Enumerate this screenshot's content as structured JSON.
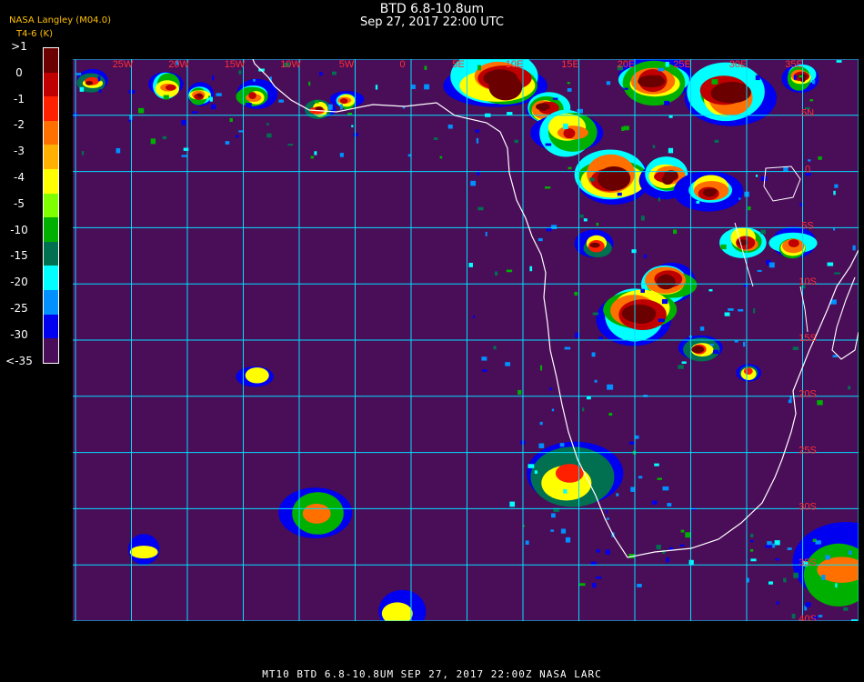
{
  "header": {
    "title": "BTD 6.8-10.8um",
    "datetime": "Sep 27, 2017 22:00 UTC",
    "credit": "NASA Langley (M04.0)",
    "units": "T4-6 (K)"
  },
  "legend": {
    "labels": [
      ">1",
      "0",
      "-1",
      "-2",
      "-3",
      "-4",
      "-5",
      "-10",
      "-15",
      "-20",
      "-25",
      "-30",
      "<-35"
    ],
    "colors": [
      "#6b0000",
      "#c00000",
      "#ff2000",
      "#ff7000",
      "#ffb000",
      "#ffff00",
      "#80ff00",
      "#00b000",
      "#007050",
      "#00ffff",
      "#0090ff",
      "#0000f0",
      "#4a0d58"
    ]
  },
  "map": {
    "background_color": "#4a0d58",
    "grid_color": "#00e0ff",
    "coast_color": "#ffffff",
    "label_color": "#ff3030",
    "lon_labels": [
      "25W",
      "20W",
      "15W",
      "10W",
      "5W",
      "0",
      "5E",
      "10E",
      "15E",
      "20E",
      "25E",
      "30E",
      "35E"
    ],
    "lat_labels": [
      "5N",
      "0",
      "5S",
      "10S",
      "15S",
      "20S",
      "25S",
      "30S",
      "35S",
      "40S"
    ]
  },
  "footer": {
    "text": "MT10   BTD 6.8-10.8UM   SEP 27, 2017 22:00Z   NASA LARC"
  }
}
